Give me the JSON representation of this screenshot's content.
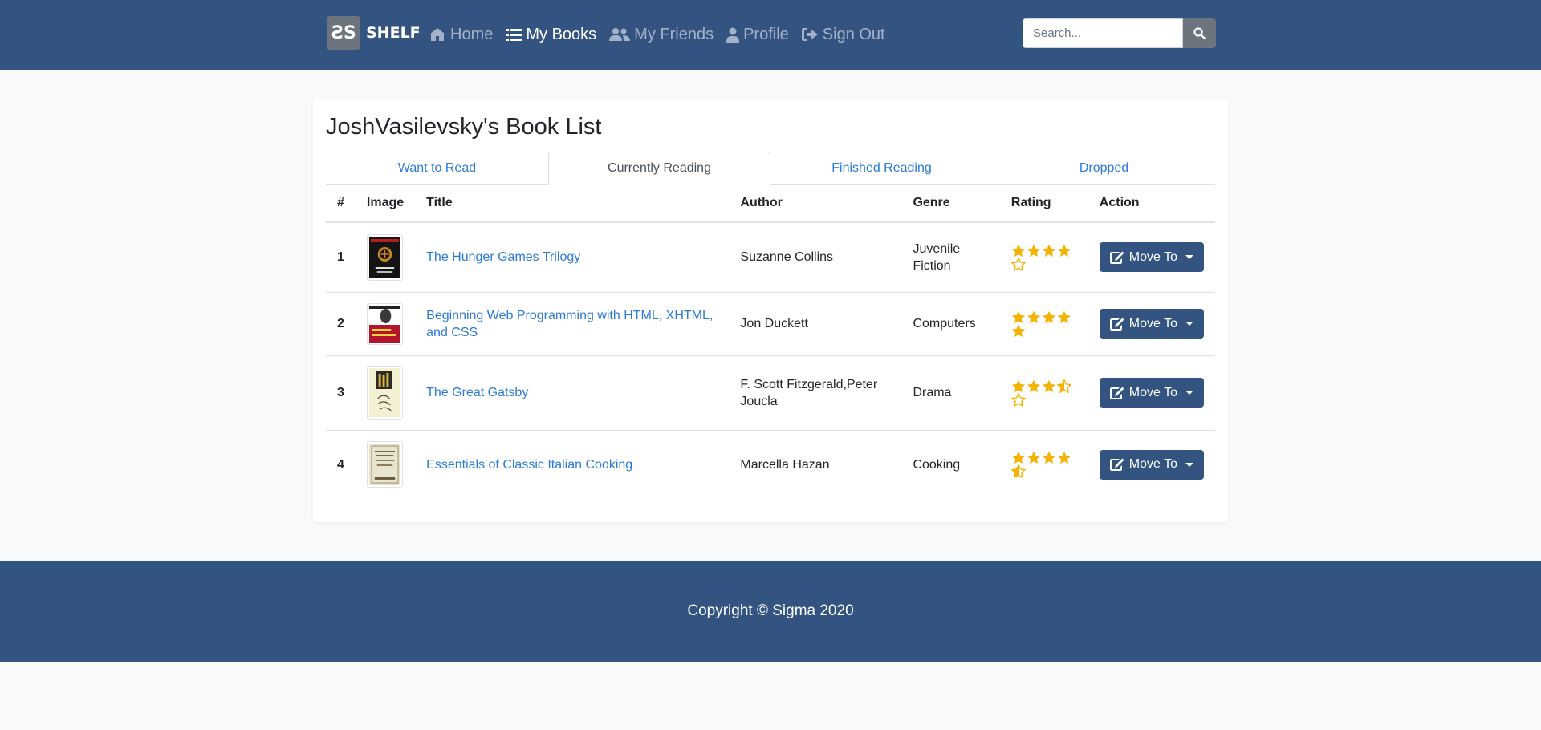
{
  "brand": {
    "logo_text": "ƧS",
    "name": "SHELF"
  },
  "nav": {
    "items": [
      {
        "label": "Home",
        "icon": "home-icon"
      },
      {
        "label": "My Books",
        "icon": "list-icon"
      },
      {
        "label": "My Friends",
        "icon": "users-icon"
      },
      {
        "label": "Profile",
        "icon": "user-icon"
      },
      {
        "label": "Sign Out",
        "icon": "sign-out-icon"
      }
    ],
    "active": "My Books"
  },
  "search": {
    "placeholder": "Search..."
  },
  "page_title": "JoshVasilevsky's Book List",
  "tabs": [
    "Want to Read",
    "Currently Reading",
    "Finished Reading",
    "Dropped"
  ],
  "active_tab": "Currently Reading",
  "table": {
    "headers": [
      "#",
      "Image",
      "Title",
      "Author",
      "Genre",
      "Rating",
      "Action"
    ],
    "rows": [
      {
        "num": "1",
        "title": "The Hunger Games Trilogy",
        "author": "Suzanne Collins",
        "genre": "Juvenile Fiction",
        "rating": 4,
        "action": "Move To"
      },
      {
        "num": "2",
        "title": "Beginning Web Programming with HTML, XHTML, and CSS",
        "author": "Jon Duckett",
        "genre": "Computers",
        "rating": 5,
        "action": "Move To"
      },
      {
        "num": "3",
        "title": "The Great Gatsby",
        "author": "F. Scott Fitzgerald,Peter Joucla",
        "genre": "Drama",
        "rating": 3.5,
        "action": "Move To"
      },
      {
        "num": "4",
        "title": "Essentials of Classic Italian Cooking",
        "author": "Marcella Hazan",
        "genre": "Cooking",
        "rating": 4.5,
        "action": "Move To"
      }
    ]
  },
  "footer": {
    "text": "Copyright © Sigma 2020"
  },
  "colors": {
    "primary": "#335481",
    "link": "#2b7bd6",
    "star": "#f5b301",
    "background": "#f8f9fa"
  }
}
